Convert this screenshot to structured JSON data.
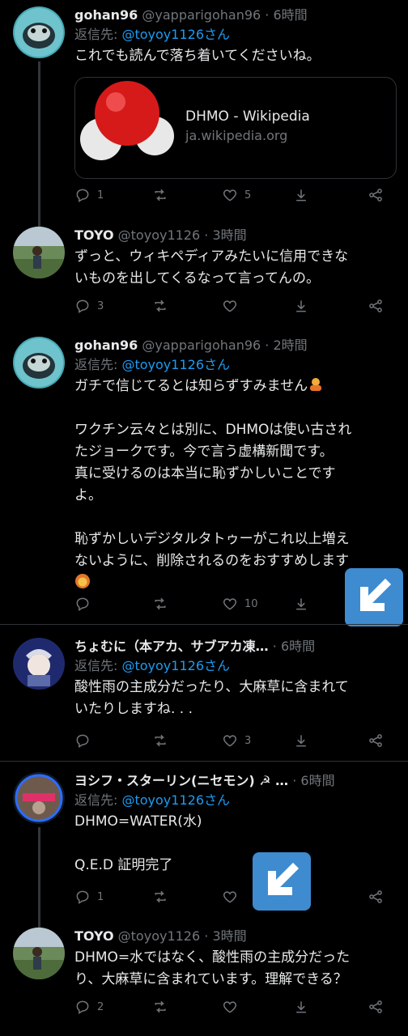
{
  "tweets": [
    {
      "name": "gohan96",
      "handle": "@yapparigohan96",
      "sep": "·",
      "time": "6時間",
      "reply_label": "返信先: ",
      "reply_to": "@toyoy1126さん",
      "text": "これでも読んで落ち着いてくださいね。",
      "card": {
        "title": "DHMO - Wikipedia",
        "domain": "ja.wikipedia.org"
      },
      "reply_count": "1",
      "retweet_count": "",
      "like_count": "5"
    },
    {
      "name": "TOYO",
      "handle": "@toyoy1126",
      "sep": "·",
      "time": "3時間",
      "text": "ずっと、ウィキペディアみたいに信用できな\nいものを出してくるなって言ってんの。",
      "reply_count": "3",
      "retweet_count": "",
      "like_count": ""
    },
    {
      "name": "gohan96",
      "handle": "@yapparigohan96",
      "sep": "·",
      "time": "2時間",
      "reply_label": "返信先: ",
      "reply_to": "@toyoy1126さん",
      "text_line1": "ガチで信じてるとは知らずすみません",
      "text": "ワクチン云々とは別に、DHMOは使い古され\nたジョークです。今で言う虚構新聞です。\n真に受けるのは本当に恥ずかしいことです\nよ。\n\n恥ずかしいデジタルタトゥーがこれ以上増え\nないように、削除されるのをおすすめします",
      "reply_count": "",
      "retweet_count": "",
      "like_count": "10"
    },
    {
      "name": "ちょむに（本アカ、サブアカ凍…",
      "sep": "·",
      "time": "6時間",
      "reply_label": "返信先: ",
      "reply_to": "@toyoy1126さん",
      "text": "酸性雨の主成分だったり、大麻草に含まれて\nいたりしますね. . .",
      "reply_count": "",
      "retweet_count": "",
      "like_count": "3"
    },
    {
      "name": "ヨシフ・スターリン(ニセモン) ☭ …",
      "sep": "·",
      "time": "6時間",
      "reply_label": "返信先: ",
      "reply_to": "@toyoy1126さん",
      "text": "DHMO=WATER(水)\n\nQ.E.D 証明完了",
      "reply_count": "1",
      "retweet_count": "",
      "like_count": ""
    },
    {
      "name": "TOYO",
      "handle": "@toyoy1126",
      "sep": "·",
      "time": "3時間",
      "text": "DHMO=水ではなく、酸性雨の主成分だった\nり、大麻草に含まれています。理解できる？",
      "reply_count": "2",
      "retweet_count": "",
      "like_count": ""
    }
  ],
  "icons": [
    "reply-icon",
    "retweet-icon",
    "like-icon",
    "download-icon",
    "share-icon",
    "arrow-down-left-icon"
  ],
  "colors": {
    "accent": "#1d9bf0",
    "muted": "#71767b",
    "badge": "#3e8bd0"
  }
}
